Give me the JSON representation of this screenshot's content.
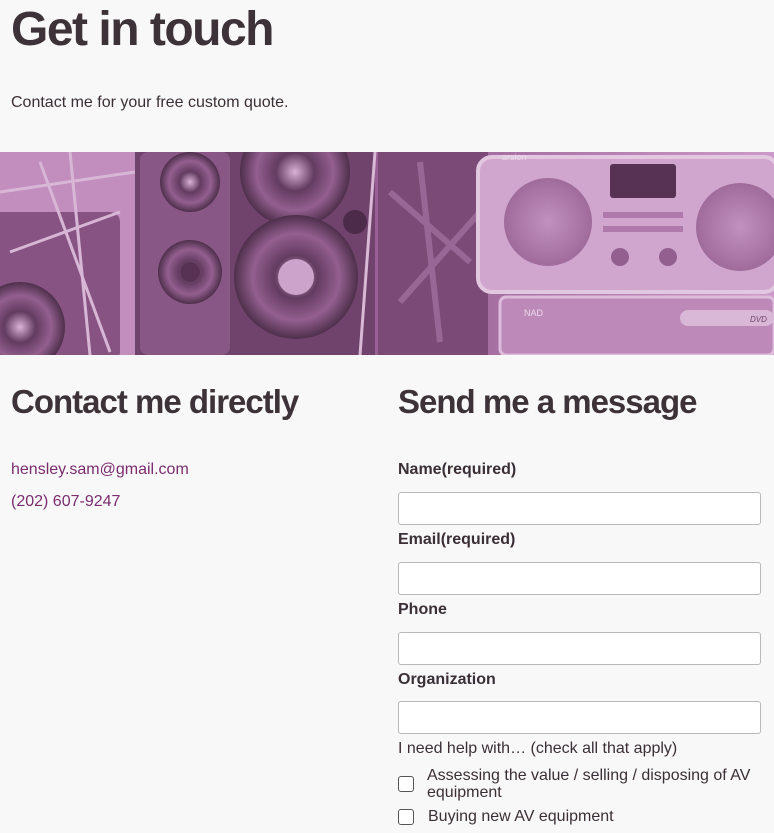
{
  "header": {
    "title": "Get in touch",
    "intro": "Contact me for your free custom quote."
  },
  "banner": {
    "tint_color": "#b070aa",
    "radio_brand": "arsion",
    "deck_brand": "NAD",
    "deck_model": "DVD"
  },
  "contact": {
    "heading": "Contact me directly",
    "email": "hensley.sam@gmail.com",
    "phone": "(202) 607-9247",
    "link_color": "#7a2c6e"
  },
  "form": {
    "heading": "Send me a message",
    "fields": [
      {
        "label": "Name(required)",
        "value": "",
        "placeholder": ""
      },
      {
        "label": "Email(required)",
        "value": "",
        "placeholder": ""
      },
      {
        "label": "Phone",
        "value": "",
        "placeholder": ""
      },
      {
        "label": "Organization",
        "value": "",
        "placeholder": ""
      }
    ],
    "help_label": "I need help with… (check all that apply)",
    "options": [
      {
        "label": "Assessing the value / selling / disposing of AV equipment",
        "checked": false
      },
      {
        "label": "Buying new AV equipment",
        "checked": false
      }
    ]
  }
}
